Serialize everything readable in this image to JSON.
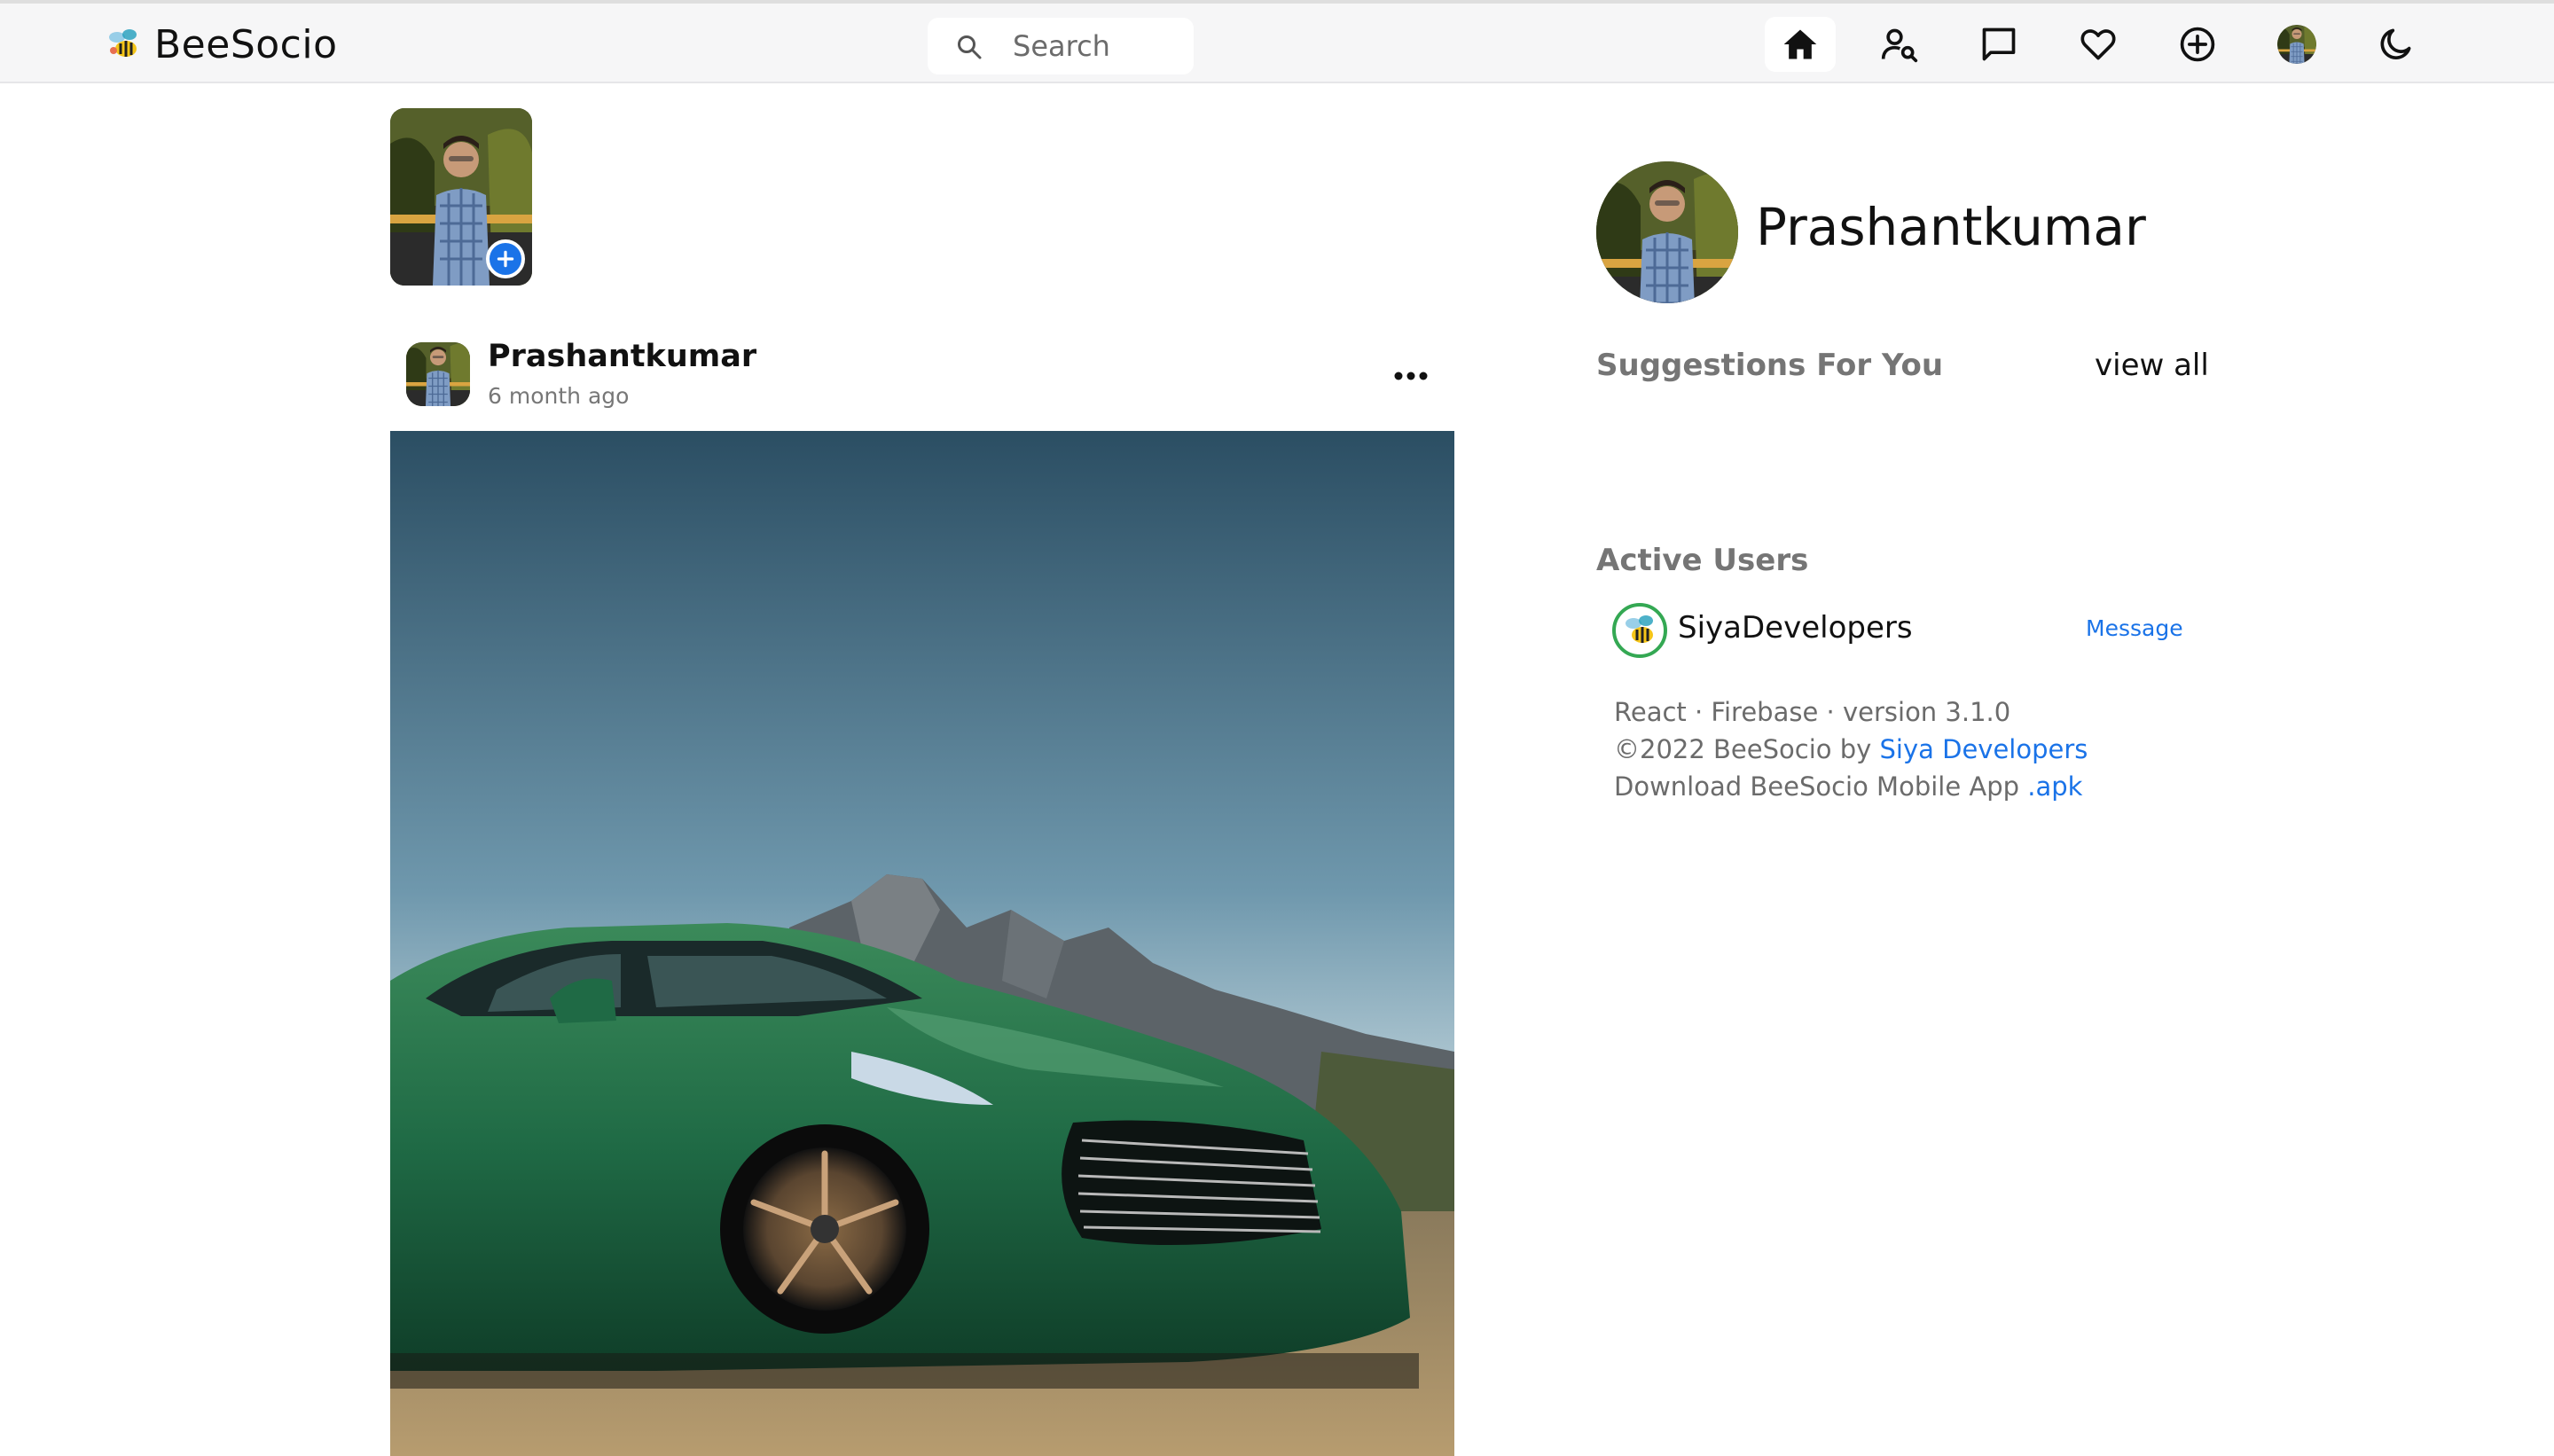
{
  "brand": {
    "name": "BeeSocio",
    "logo_icon": "bee-logo-icon"
  },
  "search": {
    "placeholder": "Search",
    "value": ""
  },
  "nav": {
    "items": [
      {
        "name": "home",
        "icon": "home-icon",
        "active": true
      },
      {
        "name": "find-people",
        "icon": "user-search-icon",
        "active": false
      },
      {
        "name": "messages",
        "icon": "chat-icon",
        "active": false
      },
      {
        "name": "notifications",
        "icon": "heart-icon",
        "active": false
      },
      {
        "name": "create-post",
        "icon": "plus-circle-icon",
        "active": false
      },
      {
        "name": "profile",
        "icon": "avatar",
        "active": false
      },
      {
        "name": "theme-toggle",
        "icon": "moon-icon",
        "active": false
      }
    ]
  },
  "story": {
    "add_icon": "plus-icon"
  },
  "post": {
    "author": "Prashantkumar",
    "time": "6 month ago",
    "more_icon": "more-horizontal-icon"
  },
  "sidebar": {
    "profile_name": "Prashantkumar",
    "suggestions_title": "Suggestions For You",
    "view_all": "view all",
    "active_title": "Active Users",
    "active_users": [
      {
        "name": "SiyaDevelopers",
        "action": "Message"
      }
    ],
    "footer": {
      "line1": "React · Firebase · version 3.1.0",
      "line2_prefix": "©2022 BeeSocio by ",
      "line2_link": "Siya Developers",
      "line3_prefix": "Download BeeSocio Mobile App ",
      "line3_link": ".apk"
    }
  },
  "colors": {
    "accent": "#1a73e8",
    "nav_bg": "#f6f6f7",
    "online_ring": "#34a853",
    "muted_text": "#757575"
  }
}
